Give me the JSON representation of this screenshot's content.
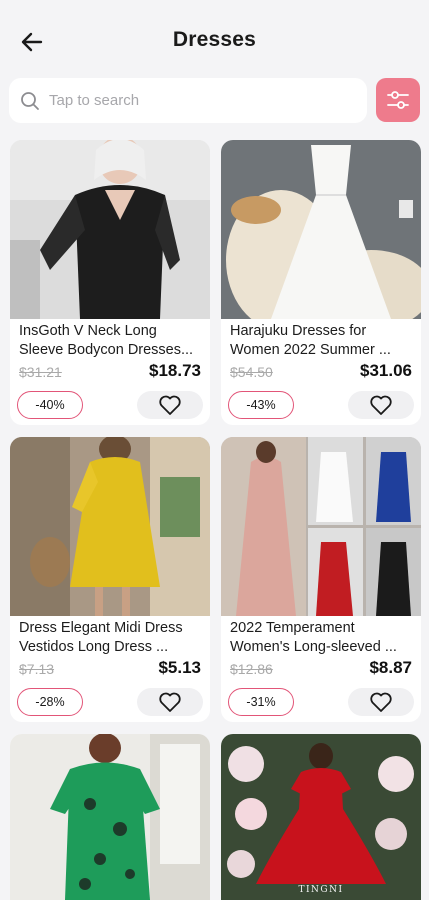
{
  "header": {
    "title": "Dresses",
    "back_icon": "back-arrow-icon"
  },
  "search": {
    "placeholder": "Tap to search",
    "value": "",
    "icon": "search-icon"
  },
  "filter": {
    "icon": "filter-sliders-icon",
    "color": "#ee7b8c"
  },
  "colors": {
    "accent": "#e25578",
    "background": "#f4f4f6"
  },
  "products": [
    {
      "name": "InsGoth V Neck Long Sleeve Bodycon Dresses...",
      "old_price": "$31.21",
      "price": "$18.73",
      "discount": "-40%"
    },
    {
      "name": "Harajuku Dresses for Women 2022 Summer ...",
      "old_price": "$54.50",
      "price": "$31.06",
      "discount": "-43%"
    },
    {
      "name": "Dress Elegant Midi Dress Vestidos Long Dress ...",
      "old_price": "$7.13",
      "price": "$5.13",
      "discount": "-28%"
    },
    {
      "name": "2022 Temperament Women's Long-sleeved ...",
      "old_price": "$12.86",
      "price": "$8.87",
      "discount": "-31%"
    },
    {
      "name": "",
      "old_price": "",
      "price": "",
      "discount": ""
    },
    {
      "name": "",
      "old_price": "",
      "price": "",
      "discount": "",
      "image_text": "TINGNI"
    }
  ]
}
